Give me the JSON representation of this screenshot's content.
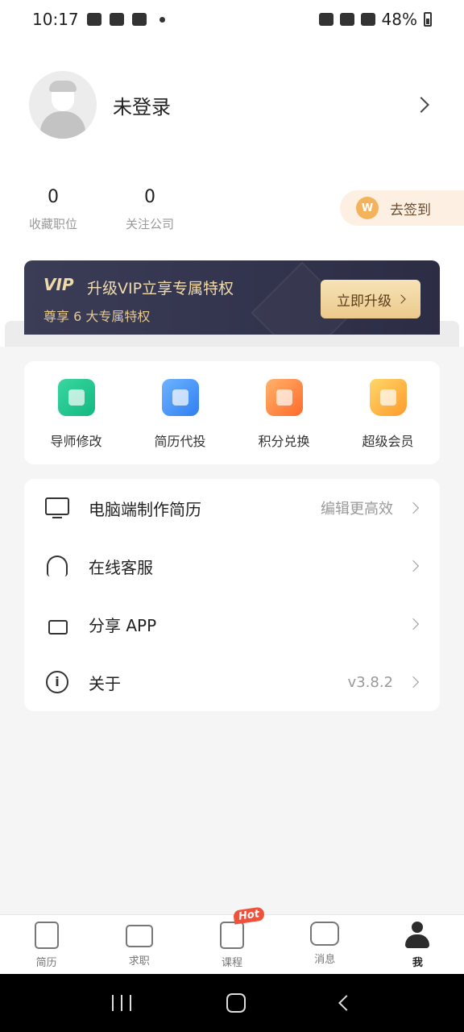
{
  "status_bar": {
    "time": "10:17",
    "battery": "48%"
  },
  "profile": {
    "name": "未登录"
  },
  "stats": [
    {
      "value": "0",
      "label": "收藏职位"
    },
    {
      "value": "0",
      "label": "关注公司"
    }
  ],
  "signin": {
    "label": "去签到",
    "coin": "W"
  },
  "vip": {
    "logo": "VIP",
    "title": "升级VIP立享专属特权",
    "subtitle": "尊享 6 大专属特权",
    "button": "立即升级"
  },
  "quick_actions": [
    {
      "label": "导师修改",
      "icon": "mentor-edit-icon",
      "color": "#12b981"
    },
    {
      "label": "简历代投",
      "icon": "resume-delivery-icon",
      "color": "#2f7ff0"
    },
    {
      "label": "积分兑换",
      "icon": "gift-icon",
      "color": "#ff6a2b"
    },
    {
      "label": "超级会员",
      "icon": "crown-icon",
      "color": "#ff9a2b"
    }
  ],
  "menu": [
    {
      "label": "电脑端制作简历",
      "value": "编辑更高效",
      "icon": "monitor-icon"
    },
    {
      "label": "在线客服",
      "value": "",
      "icon": "headset-icon"
    },
    {
      "label": "分享 APP",
      "value": "",
      "icon": "thumbs-up-icon"
    },
    {
      "label": "关于",
      "value": "v3.8.2",
      "icon": "info-icon"
    }
  ],
  "tabs": [
    {
      "label": "简历",
      "icon": "resume-icon"
    },
    {
      "label": "求职",
      "icon": "briefcase-icon"
    },
    {
      "label": "课程",
      "icon": "book-icon",
      "badge": "Hot"
    },
    {
      "label": "消息",
      "icon": "chat-icon"
    },
    {
      "label": "我",
      "icon": "person-icon",
      "active": true
    }
  ]
}
